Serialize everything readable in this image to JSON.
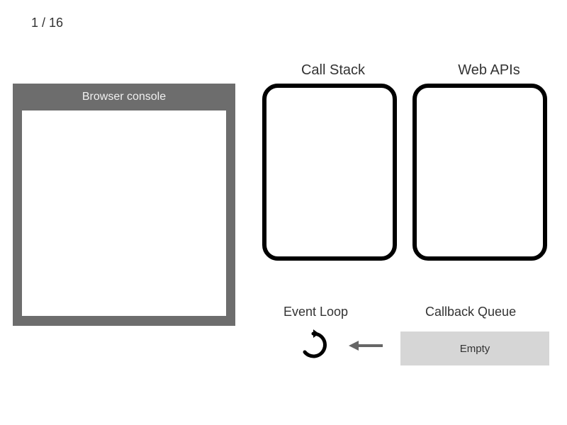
{
  "pageCounter": "1 / 16",
  "console": {
    "title": "Browser console"
  },
  "callStack": {
    "label": "Call Stack"
  },
  "webApis": {
    "label": "Web APIs"
  },
  "eventLoop": {
    "label": "Event Loop"
  },
  "callbackQueue": {
    "label": "Callback Queue",
    "status": "Empty"
  }
}
